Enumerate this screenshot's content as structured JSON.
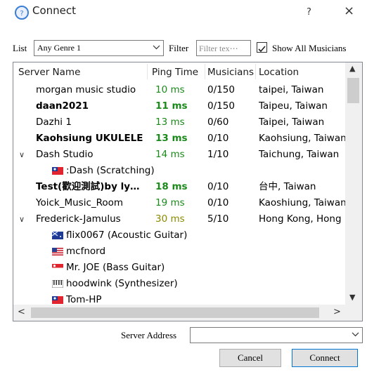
{
  "window": {
    "title": "Connect",
    "help_label": "?",
    "close_label": "×"
  },
  "toolbar": {
    "list_label": "List",
    "list_value": "Any Genre 1",
    "filter_label": "Filter",
    "filter_placeholder": "Filter tex⋯",
    "show_all_label": "Show All Musicians",
    "show_all_checked": true
  },
  "tree": {
    "columns": [
      "Server Name",
      "Ping Time",
      "Musicians",
      "Location"
    ],
    "rows": [
      {
        "name": "morgan music studio",
        "ping": "10 ms",
        "musicians": "0/150",
        "location": "taipei, Taiwan",
        "bold": false
      },
      {
        "name": "daan2021",
        "ping": "11 ms",
        "musicians": "0/150",
        "location": "Taipeu, Taiwan",
        "bold": true
      },
      {
        "name": "Dazhi 1",
        "ping": "13 ms",
        "musicians": "0/60",
        "location": "Taipei, Taiwan",
        "bold": false
      },
      {
        "name": "Kaohsiung UKULELE",
        "ping": "13 ms",
        "musicians": "0/10",
        "location": "Kaohsiung, Taiwan",
        "bold": true
      },
      {
        "name": "Dash Studio",
        "ping": "14 ms",
        "musicians": "1/10",
        "location": "Taichung, Taiwan",
        "bold": false,
        "expanded": true
      },
      {
        "name": ":Dash (Scratching)",
        "flag": "taiwan",
        "child": true
      },
      {
        "name": "Test(歡迎測試)by ly…",
        "ping": "18 ms",
        "musicians": "0/10",
        "location": "台中, Taiwan",
        "bold": true
      },
      {
        "name": "Yoick_Music_Room",
        "ping": "19 ms",
        "musicians": "0/10",
        "location": "Kaoshiung, Taiwan",
        "bold": false
      },
      {
        "name": "Frederick-Jamulus",
        "ping": "30 ms",
        "musicians": "5/10",
        "location": "Hong Kong, Hong Kong",
        "bold": false,
        "expanded": true
      },
      {
        "name": "flix0067 (Acoustic Guitar)",
        "flag": "australia",
        "child": true
      },
      {
        "name": "mcfnord",
        "flag": "usa",
        "child": true
      },
      {
        "name": "Mr. JOE (Bass Guitar)",
        "flag": "singapore",
        "child": true
      },
      {
        "name": "hoodwink (Synthesizer)",
        "flag": "synth",
        "child": true
      },
      {
        "name": "Tom-HP",
        "flag": "taiwan",
        "child": true
      }
    ]
  },
  "address": {
    "label": "Server Address",
    "value": ""
  },
  "buttons": {
    "cancel": "Cancel",
    "connect": "Connect"
  },
  "colors": {
    "ping_good": "#1a8a1a",
    "ping_warn": "#8a8a00",
    "accent": "#0078d7"
  }
}
